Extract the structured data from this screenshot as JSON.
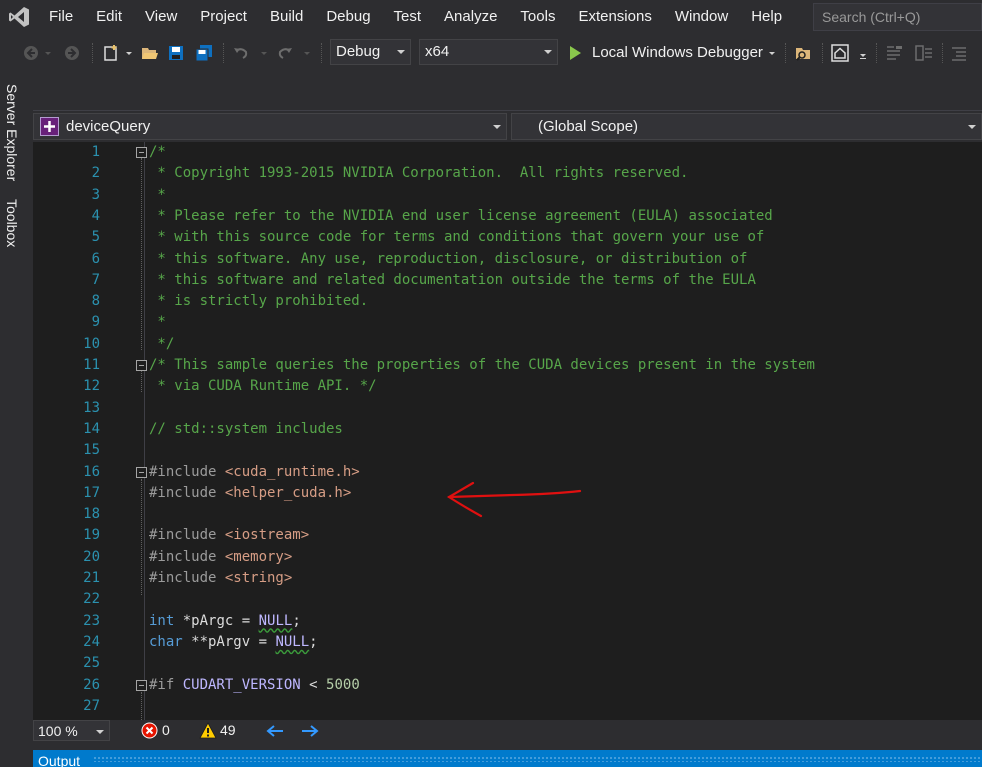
{
  "menu": {
    "items": [
      "File",
      "Edit",
      "View",
      "Project",
      "Build",
      "Debug",
      "Test",
      "Analyze",
      "Tools",
      "Extensions",
      "Window",
      "Help"
    ],
    "search_placeholder": "Search (Ctrl+Q)"
  },
  "toolbar": {
    "configuration": "Debug",
    "platform": "x64",
    "debugger": "Local Windows Debugger"
  },
  "side_tabs": [
    "Server Explorer",
    "Toolbox"
  ],
  "editor": {
    "project_combo": "deviceQuery",
    "scope_combo": "(Global Scope)",
    "lines": [
      {
        "n": "1",
        "tokens": [
          {
            "t": "/*",
            "c": "cm"
          }
        ]
      },
      {
        "n": "2",
        "tokens": [
          {
            "t": " * Copyright 1993-2015 NVIDIA Corporation.  All rights reserved.",
            "c": "cm"
          }
        ]
      },
      {
        "n": "3",
        "tokens": [
          {
            "t": " *",
            "c": "cm"
          }
        ]
      },
      {
        "n": "4",
        "tokens": [
          {
            "t": " * Please refer to the NVIDIA end user license agreement (EULA) associated",
            "c": "cm"
          }
        ]
      },
      {
        "n": "5",
        "tokens": [
          {
            "t": " * with this source code for terms and conditions that govern your use of",
            "c": "cm"
          }
        ]
      },
      {
        "n": "6",
        "tokens": [
          {
            "t": " * this software. Any use, reproduction, disclosure, or distribution of",
            "c": "cm"
          }
        ]
      },
      {
        "n": "7",
        "tokens": [
          {
            "t": " * this software and related documentation outside the terms of the EULA",
            "c": "cm"
          }
        ]
      },
      {
        "n": "8",
        "tokens": [
          {
            "t": " * is strictly prohibited.",
            "c": "cm"
          }
        ]
      },
      {
        "n": "9",
        "tokens": [
          {
            "t": " *",
            "c": "cm"
          }
        ]
      },
      {
        "n": "10",
        "tokens": [
          {
            "t": " */",
            "c": "cm"
          }
        ]
      },
      {
        "n": "11",
        "tokens": [
          {
            "t": "/* This sample queries the properties of the CUDA devices present in the system",
            "c": "cm"
          }
        ]
      },
      {
        "n": "12",
        "tokens": [
          {
            "t": " * via CUDA Runtime API. */",
            "c": "cm"
          }
        ]
      },
      {
        "n": "13",
        "tokens": []
      },
      {
        "n": "14",
        "tokens": [
          {
            "t": "// std::system includes",
            "c": "cm"
          }
        ]
      },
      {
        "n": "15",
        "tokens": []
      },
      {
        "n": "16",
        "tokens": [
          {
            "t": "#include ",
            "c": "pp"
          },
          {
            "t": "<cuda_runtime.h>",
            "c": "str"
          }
        ]
      },
      {
        "n": "17",
        "tokens": [
          {
            "t": "#include ",
            "c": "pp"
          },
          {
            "t": "<helper_cuda.h>",
            "c": "str"
          }
        ]
      },
      {
        "n": "18",
        "tokens": []
      },
      {
        "n": "19",
        "tokens": [
          {
            "t": "#include ",
            "c": "pp"
          },
          {
            "t": "<iostream>",
            "c": "str"
          }
        ]
      },
      {
        "n": "20",
        "tokens": [
          {
            "t": "#include ",
            "c": "pp"
          },
          {
            "t": "<memory>",
            "c": "str"
          }
        ]
      },
      {
        "n": "21",
        "tokens": [
          {
            "t": "#include ",
            "c": "pp"
          },
          {
            "t": "<string>",
            "c": "str"
          }
        ]
      },
      {
        "n": "22",
        "tokens": []
      },
      {
        "n": "23",
        "tokens": [
          {
            "t": "int",
            "c": "kw"
          },
          {
            "t": " *pArgc = ",
            "c": ""
          },
          {
            "t": "NULL",
            "c": "mac"
          },
          {
            "t": ";",
            "c": ""
          }
        ]
      },
      {
        "n": "24",
        "tokens": [
          {
            "t": "char",
            "c": "kw"
          },
          {
            "t": " **pArgv = ",
            "c": ""
          },
          {
            "t": "NULL",
            "c": "mac"
          },
          {
            "t": ";",
            "c": ""
          }
        ]
      },
      {
        "n": "25",
        "tokens": []
      },
      {
        "n": "26",
        "tokens": [
          {
            "t": "#if ",
            "c": "pp"
          },
          {
            "t": "CUDART_VERSION",
            "c": "mac"
          },
          {
            "t": " < ",
            "c": ""
          },
          {
            "t": "5000",
            "c": "num"
          }
        ]
      },
      {
        "n": "27",
        "tokens": []
      }
    ]
  },
  "status": {
    "zoom": "100 %",
    "errors": "0",
    "warnings": "49"
  },
  "output_panel": {
    "title": "Output"
  }
}
